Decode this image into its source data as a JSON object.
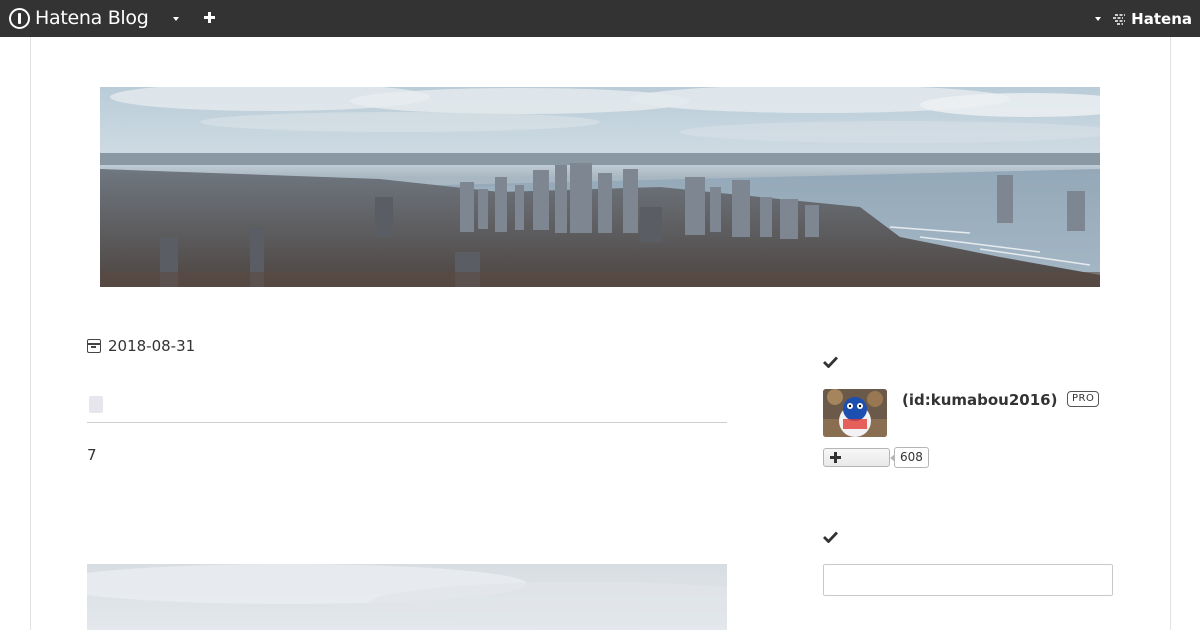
{
  "topbar": {
    "brand": "Hatena Blog",
    "right_brand": "Hatena"
  },
  "article": {
    "date": "2018-08-31",
    "body": "7"
  },
  "sidebar": {
    "profile": {
      "user_id": "(id:kumabou2016)",
      "badge": "PRO",
      "follower_count": "608"
    },
    "search": {
      "placeholder": ""
    }
  },
  "colors": {
    "topbar": "#333333",
    "border": "#e2e2e2",
    "text": "#333333"
  }
}
